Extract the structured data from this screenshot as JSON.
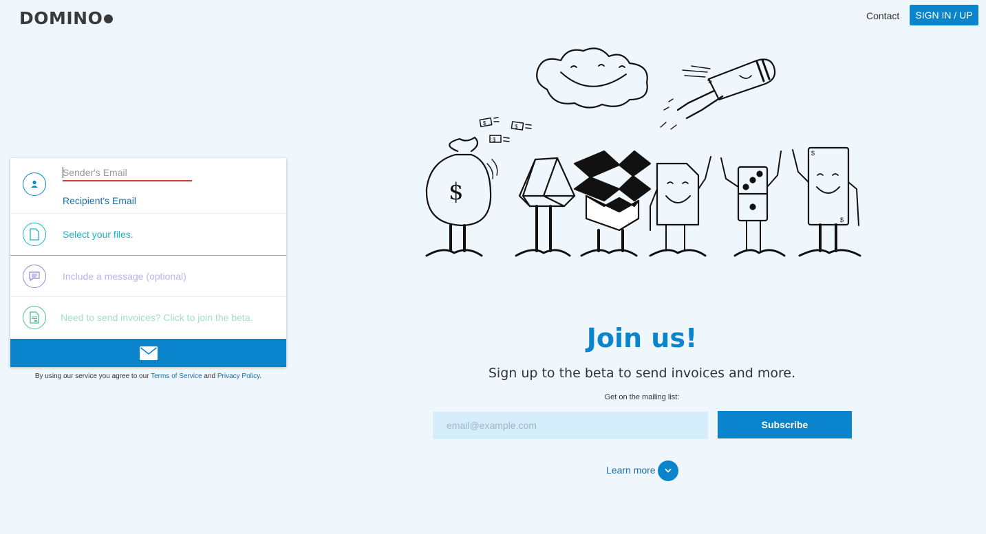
{
  "header": {
    "logo": "DOMINO",
    "contact_label": "Contact",
    "signin_label": "SIGN IN / UP"
  },
  "form": {
    "sender_placeholder": "Sender's Email",
    "recipient_label": "Recipient's Email",
    "files_label": "Select your files.",
    "message_placeholder": "Include a message (optional)",
    "invoice_label": "Need to send invoices? Click to join the beta.",
    "icons": [
      "user-icon",
      "file-icon",
      "message-icon",
      "invoice-icon",
      "envelope-icon"
    ]
  },
  "terms": {
    "prefix": "By using our service you agree to our",
    "terms_link": "Terms of Service",
    "and": "and",
    "privacy_link": "Privacy Policy",
    "suffix": "."
  },
  "join": {
    "title": "Join us!",
    "subtitle": "Sign up to the beta to send invoices and more.",
    "mailing_label": "Get on the mailing list:",
    "email_placeholder": "email@example.com",
    "subscribe_label": "Subscribe",
    "learn_more_label": "Learn more"
  },
  "colors": {
    "accent": "#0a84cc",
    "background": "#eff7fd",
    "error_underline": "#d9342b",
    "teal": "#17b5c4",
    "lavender": "#8a8ad6",
    "green": "#4cc08e"
  }
}
